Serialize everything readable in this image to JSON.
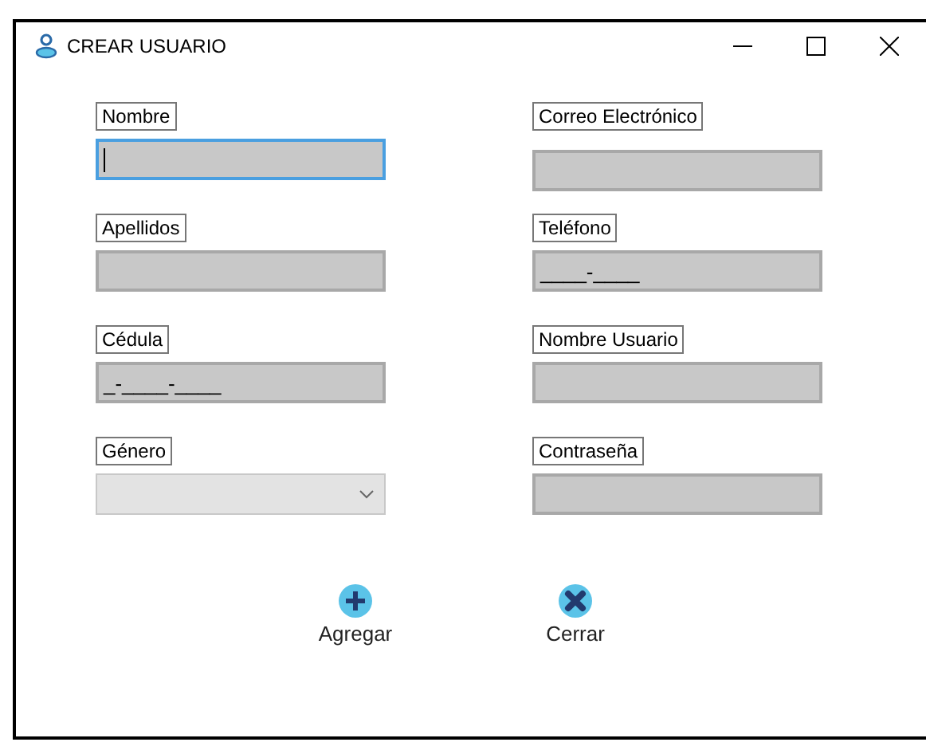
{
  "window": {
    "title": "CREAR USUARIO"
  },
  "columns": [
    {
      "fields": [
        {
          "label": "Nombre",
          "kind": "text",
          "focused": true
        },
        {
          "label": "Apellidos",
          "kind": "text",
          "focused": false
        },
        {
          "label": "Cédula",
          "kind": "text",
          "value": "_-____-____",
          "focused": false
        },
        {
          "label": "Género",
          "kind": "combo",
          "focused": false
        }
      ]
    },
    {
      "fields": [
        {
          "label": "Correo Electrónico",
          "kind": "text",
          "focused": false
        },
        {
          "label": "Teléfono",
          "kind": "text",
          "value": "____-____",
          "focused": false
        },
        {
          "label": "Nombre Usuario",
          "kind": "text",
          "focused": false
        },
        {
          "label": "Contraseña",
          "kind": "text",
          "focused": false
        }
      ]
    }
  ],
  "buttons": [
    {
      "label": "Agregar",
      "kind": "add"
    },
    {
      "label": "Cerrar",
      "kind": "close"
    }
  ]
}
